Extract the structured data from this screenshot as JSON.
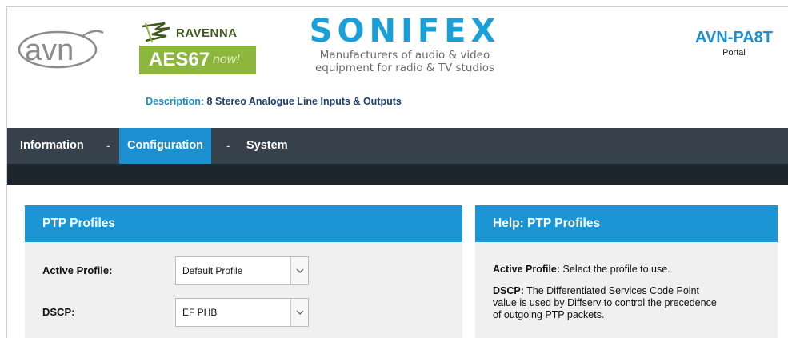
{
  "header": {
    "avn_logo_text": "avn",
    "ravenna_text": "RAVENNA",
    "aes_text": "AES67",
    "now_text": "now!",
    "sonifex_text": "SONIFEX",
    "sonifex_tagline_1": "Manufacturers of audio & video",
    "sonifex_tagline_2": "equipment for radio & TV studios",
    "product_name": "AVN-PA8T",
    "product_sub": "Portal",
    "description_label": "Description:",
    "description_value": "8 Stereo Analogue Line Inputs & Outputs"
  },
  "nav": {
    "items": [
      {
        "label": "Information"
      },
      {
        "label": "Configuration"
      },
      {
        "label": "System"
      }
    ],
    "separator": "-",
    "active": "Configuration"
  },
  "ptp_panel": {
    "title": "PTP Profiles",
    "active_profile_label": "Active Profile:",
    "active_profile_value": "Default Profile",
    "dscp_label": "DSCP:",
    "dscp_value": "EF PHB"
  },
  "help_panel": {
    "title": "Help: PTP Profiles",
    "active_profile_term": "Active Profile:",
    "active_profile_text": "Select the profile to use.",
    "dscp_term": "DSCP:",
    "dscp_text_1": "The Differentiated Services Code Point",
    "dscp_text_2": "value is used by Diffserv to control the precedence",
    "dscp_text_3": "of outgoing PTP packets."
  },
  "colors": {
    "accent_blue": "#1b8fd0",
    "nav_bg": "#37414c",
    "subnav_bg": "#1d252d",
    "panel_bg": "#f0f0f0",
    "aes_green": "#8db63c"
  },
  "icons": {
    "select_arrow": "chevron-down-icon",
    "ravenna_mark": "ravenna-logo-icon"
  }
}
